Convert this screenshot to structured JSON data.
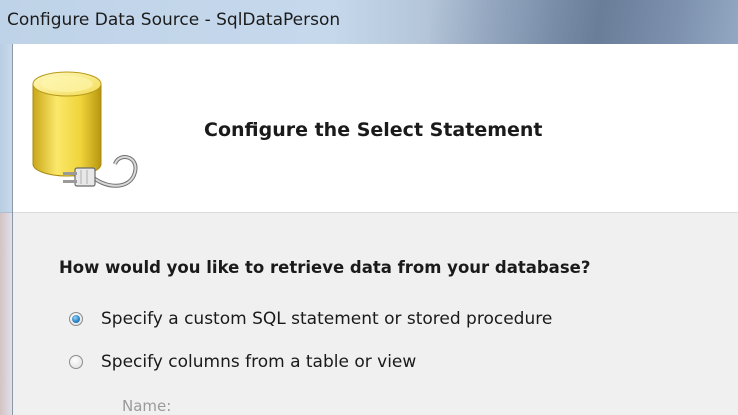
{
  "window": {
    "title": "Configure Data Source - SqlDataPerson"
  },
  "header": {
    "title": "Configure the Select Statement",
    "icon": "database-connection-icon"
  },
  "main": {
    "question": "How would you like to retrieve data from your database?",
    "options": [
      {
        "label": "Specify a custom SQL statement or stored procedure",
        "selected": true
      },
      {
        "label": "Specify columns from a table or view",
        "selected": false
      }
    ],
    "name_label": "Name:"
  },
  "colors": {
    "accent": "#2a86c8",
    "header_bg": "#ffffff",
    "dialog_bg": "#f0f0f0"
  }
}
